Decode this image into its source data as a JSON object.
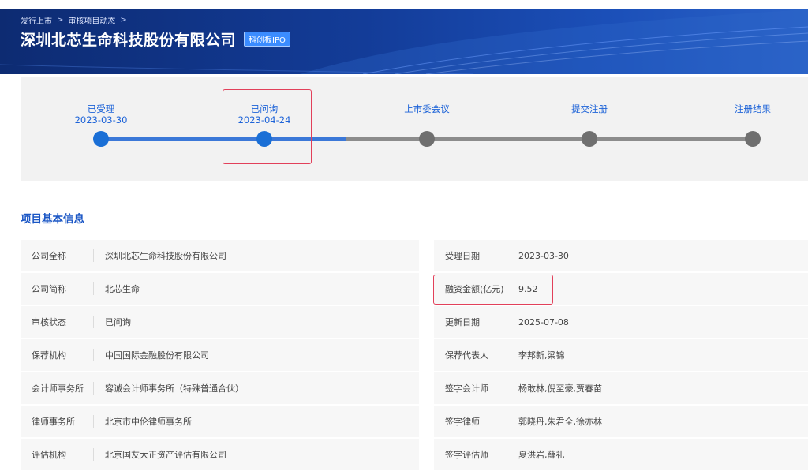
{
  "breadcrumb": {
    "item1": "发行上市",
    "item2": "审核项目动态",
    "sep": ">"
  },
  "header": {
    "title": "深圳北芯生命科技股份有限公司",
    "badge": "科创板IPO"
  },
  "steps": [
    {
      "label": "已受理",
      "date": "2023-03-30",
      "status": "done"
    },
    {
      "label": "已问询",
      "date": "2023-04-24",
      "status": "current"
    },
    {
      "label": "上市委会议",
      "date": "",
      "status": "todo"
    },
    {
      "label": "提交注册",
      "date": "",
      "status": "todo"
    },
    {
      "label": "注册结果",
      "date": "",
      "status": "todo"
    }
  ],
  "section": {
    "title": "项目基本信息"
  },
  "info_left": [
    {
      "label": "公司全称",
      "value": "深圳北芯生命科技股份有限公司"
    },
    {
      "label": "公司简称",
      "value": "北芯生命"
    },
    {
      "label": "审核状态",
      "value": "已问询"
    },
    {
      "label": "保荐机构",
      "value": "中国国际金融股份有限公司"
    },
    {
      "label": "会计师事务所",
      "value": "容诚会计师事务所（特殊普通合伙）"
    },
    {
      "label": "律师事务所",
      "value": "北京市中伦律师事务所"
    },
    {
      "label": "评估机构",
      "value": "北京国友大正资产评估有限公司"
    }
  ],
  "info_right": [
    {
      "label": "受理日期",
      "value": "2023-03-30"
    },
    {
      "label": "融资金额(亿元)",
      "value": "9.52"
    },
    {
      "label": "更新日期",
      "value": "2025-07-08"
    },
    {
      "label": "保荐代表人",
      "value": "李邦新,梁锦"
    },
    {
      "label": "签字会计师",
      "value": "杨敢林,倪至豪,贾春苗"
    },
    {
      "label": "签字律师",
      "value": "郭晓丹,朱君全,徐亦林"
    },
    {
      "label": "签字评估师",
      "value": "夏洪岩,薛礼"
    }
  ],
  "colors": {
    "banner": "#133c98",
    "accent": "#1d63d8",
    "highlight": "#e2405a"
  }
}
